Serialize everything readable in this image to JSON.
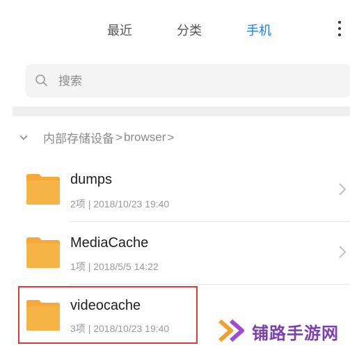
{
  "tabs": [
    {
      "label": "最近"
    },
    {
      "label": "分类"
    },
    {
      "label": "手机"
    }
  ],
  "active_tab": "手机",
  "accent_color": "#1f7ef0",
  "search": {
    "placeholder": "搜索"
  },
  "breadcrumb": {
    "root": "内部存储设备",
    "current": "browser",
    "separator": ">"
  },
  "folders": [
    {
      "name": "dumps",
      "count": "2项",
      "date": "2018/10/23 19:40"
    },
    {
      "name": "MediaCache",
      "count": "1项",
      "date": "2018/5/5 14:22"
    },
    {
      "name": "videocache",
      "count": "3项",
      "date": "2018/10/23 19:40"
    }
  ],
  "meta_separator": "|",
  "folder_color": "#f5a93a",
  "highlight_color": "#e0393c",
  "watermark": {
    "text": "铺路手游网"
  }
}
